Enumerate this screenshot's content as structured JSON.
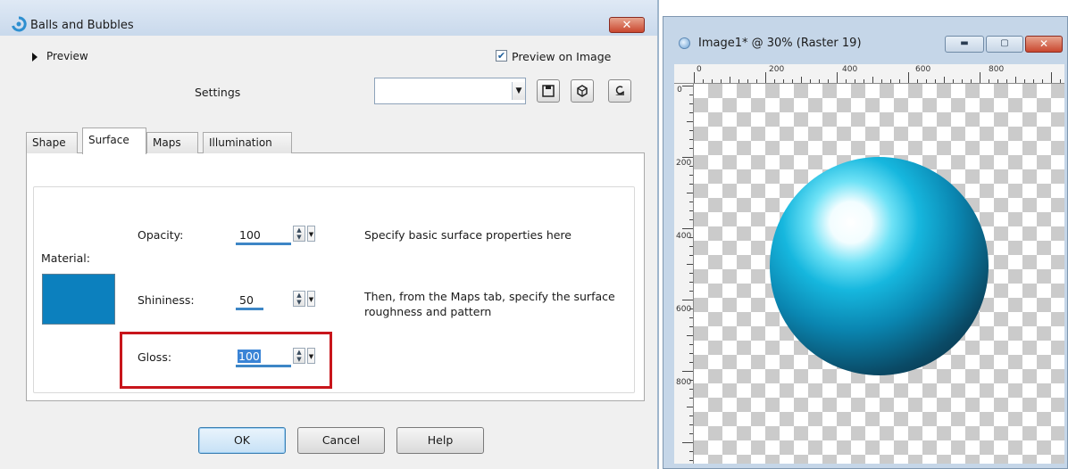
{
  "dialog": {
    "title": "Balls and Bubbles",
    "close_label": "✕",
    "preview_label": "Preview",
    "preview_on_image": {
      "label": "Preview on Image",
      "checked": true
    },
    "settings_label": "Settings",
    "settings_value": "",
    "toolbar_icons": [
      "save-icon",
      "load-icon",
      "reset-icon"
    ],
    "tabs": [
      {
        "label": "Shape",
        "active": false
      },
      {
        "label": "Surface",
        "active": true
      },
      {
        "label": "Maps",
        "active": false
      },
      {
        "label": "Illumination",
        "active": false
      }
    ],
    "surface": {
      "material_label": "Material:",
      "material_color": "#0c80be",
      "opacity": {
        "label": "Opacity:",
        "value": "100"
      },
      "shininess": {
        "label": "Shininess:",
        "value": "50"
      },
      "gloss": {
        "label": "Gloss:",
        "value": "100",
        "selected": true,
        "highlighted": true
      },
      "hint_1": "Specify basic surface properties here",
      "hint_2": "Then, from the Maps tab, specify the surface roughness and pattern"
    },
    "buttons": {
      "ok": "OK",
      "cancel": "Cancel",
      "help": "Help"
    }
  },
  "image_window": {
    "title": "Image1* @  30% (Raster 19)",
    "ruler_top_labels": [
      "0",
      "200",
      "400",
      "600",
      "800"
    ],
    "ruler_left_labels": [
      "0",
      "200",
      "400",
      "600",
      "800"
    ],
    "ball_colors": {
      "highlight": "#ffffff",
      "mid": "#16b7de",
      "shadow": "#06202d"
    }
  }
}
